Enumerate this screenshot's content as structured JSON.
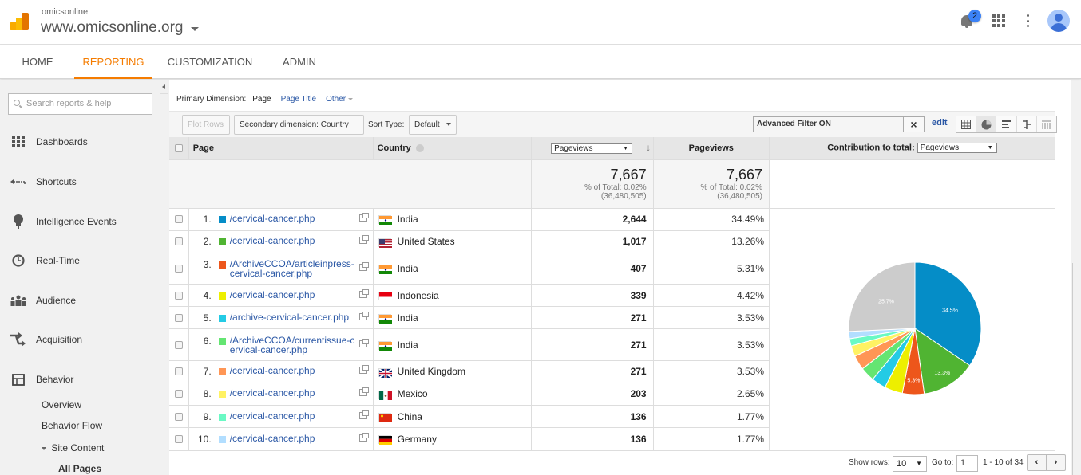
{
  "header": {
    "account": "omicsonline",
    "property": "www.omicsonline.org",
    "notifications_count": "2"
  },
  "nav": {
    "tabs": [
      {
        "label": "HOME",
        "active": false
      },
      {
        "label": "REPORTING",
        "active": true
      },
      {
        "label": "CUSTOMIZATION",
        "active": false
      },
      {
        "label": "ADMIN",
        "active": false
      }
    ]
  },
  "sidebar": {
    "search_placeholder": "Search reports & help",
    "items": [
      {
        "label": "Dashboards",
        "icon": "dashboards-icon"
      },
      {
        "label": "Shortcuts",
        "icon": "shortcuts-icon"
      },
      {
        "label": "Intelligence Events",
        "icon": "lightbulb-icon"
      },
      {
        "label": "Real-Time",
        "icon": "clock-icon"
      },
      {
        "label": "Audience",
        "icon": "people-icon"
      },
      {
        "label": "Acquisition",
        "icon": "arrows-icon"
      },
      {
        "label": "Behavior",
        "icon": "layout-icon"
      }
    ],
    "behavior_sub": {
      "overview": "Overview",
      "behavior_flow": "Behavior Flow",
      "site_content": "Site Content",
      "all_pages": "All Pages"
    }
  },
  "report": {
    "primary_dimension_label": "Primary Dimension:",
    "primary_options": {
      "selected": "Page",
      "page_title": "Page Title",
      "other": "Other"
    },
    "toolbar": {
      "plot_rows": "Plot Rows",
      "secondary_dimension": "Secondary dimension: Country",
      "sort_type_label": "Sort Type:",
      "sort_type_value": "Default",
      "filter_value": "Advanced Filter ON",
      "edit": "edit"
    },
    "columns": {
      "page": "Page",
      "country": "Country",
      "metric_select": "Pageviews",
      "pageviews": "Pageviews",
      "contribution_label": "Contribution to total:",
      "contribution_select": "Pageviews"
    },
    "totals": {
      "value1": "7,667",
      "pct1": "% of Total: 0.02%",
      "base1": "(36,480,505)",
      "value2": "7,667",
      "pct2": "% of Total: 0.02%",
      "base2": "(36,480,505)"
    },
    "rows": [
      {
        "rank": "1.",
        "color": "#058dc7",
        "page": "/cervical-cancer.php",
        "country": "India",
        "flag": "in",
        "pageviews": "2,644",
        "pct": "34.49%"
      },
      {
        "rank": "2.",
        "color": "#50b432",
        "page": "/cervical-cancer.php",
        "country": "United States",
        "flag": "us",
        "pageviews": "1,017",
        "pct": "13.26%"
      },
      {
        "rank": "3.",
        "color": "#ed561b",
        "page": "/ArchiveCCOA/articleinpress-cervical-cancer.php",
        "country": "India",
        "flag": "in",
        "pageviews": "407",
        "pct": "5.31%"
      },
      {
        "rank": "4.",
        "color": "#edef00",
        "page": "/cervical-cancer.php",
        "country": "Indonesia",
        "flag": "id",
        "pageviews": "339",
        "pct": "4.42%"
      },
      {
        "rank": "5.",
        "color": "#24cbe5",
        "page": "/archive-cervical-cancer.php",
        "country": "India",
        "flag": "in",
        "pageviews": "271",
        "pct": "3.53%"
      },
      {
        "rank": "6.",
        "color": "#64e572",
        "page": "/ArchiveCCOA/currentissue-cervical-cancer.php",
        "country": "India",
        "flag": "in",
        "pageviews": "271",
        "pct": "3.53%"
      },
      {
        "rank": "7.",
        "color": "#ff9655",
        "page": "/cervical-cancer.php",
        "country": "United Kingdom",
        "flag": "gb",
        "pageviews": "271",
        "pct": "3.53%"
      },
      {
        "rank": "8.",
        "color": "#fff263",
        "page": "/cervical-cancer.php",
        "country": "Mexico",
        "flag": "mx",
        "pageviews": "203",
        "pct": "2.65%"
      },
      {
        "rank": "9.",
        "color": "#6af9c4",
        "page": "/cervical-cancer.php",
        "country": "China",
        "flag": "cn",
        "pageviews": "136",
        "pct": "1.77%"
      },
      {
        "rank": "10.",
        "color": "#b2deff",
        "page": "/cervical-cancer.php",
        "country": "Germany",
        "flag": "de",
        "pageviews": "136",
        "pct": "1.77%"
      }
    ],
    "pagination": {
      "show_rows_label": "Show rows:",
      "show_rows_value": "10",
      "goto_label": "Go to:",
      "goto_value": "1",
      "range": "1 - 10 of 34"
    }
  },
  "chart_data": {
    "type": "pie",
    "title": "Contribution to total: Pageviews",
    "labels": [
      "1",
      "2",
      "3",
      "4",
      "5",
      "6",
      "7",
      "8",
      "9",
      "10",
      "Other"
    ],
    "values": [
      34.49,
      13.26,
      5.31,
      4.42,
      3.53,
      3.53,
      3.53,
      2.65,
      1.77,
      1.77,
      25.74
    ],
    "colors": [
      "#058dc7",
      "#50b432",
      "#ed561b",
      "#edef00",
      "#24cbe5",
      "#64e572",
      "#ff9655",
      "#fff263",
      "#6af9c4",
      "#b2deff",
      "#cccccc"
    ],
    "data_labels": [
      "34.5%",
      "13.3%",
      "5.3%",
      "",
      "",
      "",
      "",
      "",
      "",
      "",
      "25.7%"
    ]
  }
}
